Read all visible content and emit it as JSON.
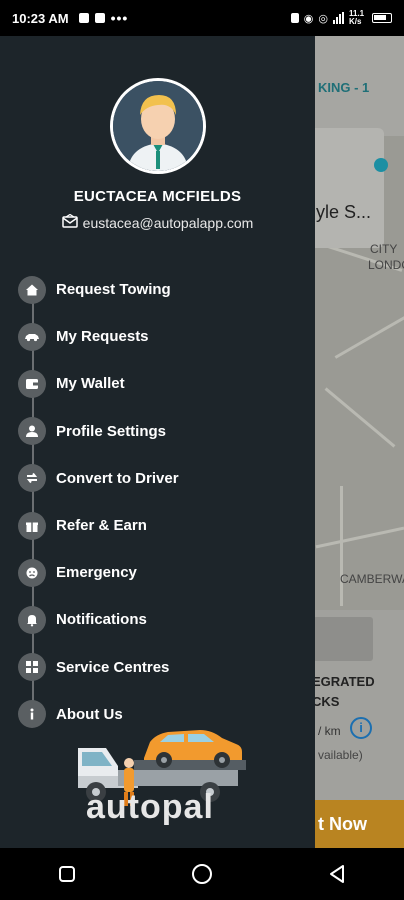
{
  "status_bar": {
    "time": "10:23 AM",
    "dots": "•••",
    "speed": "11.1 K/s"
  },
  "map": {
    "booking_label": "KING - 1",
    "search_text": "yle S...",
    "label_city": "CITY",
    "label_london": "LONDO",
    "label_camberwell": "CAMBERWA",
    "service_title_line1": "EGRATED",
    "service_title_line2": "CKS",
    "price_text": "/ km",
    "availability_text": "vailable)",
    "book_button": "t Now"
  },
  "drawer": {
    "user_name": "EUCTACEA MCFIELDS",
    "user_email": "eustacea@autopalapp.com",
    "menu": [
      {
        "label": "Request Towing",
        "icon": "home-icon"
      },
      {
        "label": "My Requests",
        "icon": "car-icon"
      },
      {
        "label": "My Wallet",
        "icon": "wallet-icon"
      },
      {
        "label": "Profile Settings",
        "icon": "user-settings-icon"
      },
      {
        "label": "Convert to Driver",
        "icon": "swap-icon"
      },
      {
        "label": "Refer & Earn",
        "icon": "gift-icon"
      },
      {
        "label": "Emergency",
        "icon": "emergency-icon"
      },
      {
        "label": "Notifications",
        "icon": "bell-icon"
      },
      {
        "label": "Service Centres",
        "icon": "grid-icon"
      },
      {
        "label": "About Us",
        "icon": "info-icon"
      }
    ],
    "logo_text": "autopal"
  },
  "colors": {
    "drawer_bg": "#1d252a",
    "accent_orange": "#f29a2e",
    "book_button": "#b98421",
    "map_accent": "#1f6f77"
  }
}
